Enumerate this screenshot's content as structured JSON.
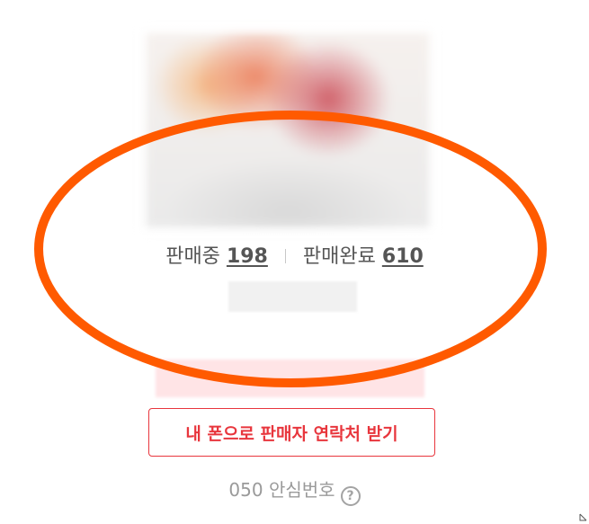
{
  "seller": {
    "selling_label": "판매중",
    "selling_count": "198",
    "sold_label": "판매완료",
    "sold_count": "610"
  },
  "contact_button": {
    "label": "내 폰으로 판매자 연락처 받기"
  },
  "safe_number": {
    "label": "050 안심번호",
    "help_glyph": "?"
  },
  "colors": {
    "accent": "#e8363d",
    "annotation": "#ff5a00",
    "muted_text": "#9a9a9a"
  },
  "icons": {
    "help": "question-circle-icon",
    "resize": "resize-corner-icon"
  }
}
